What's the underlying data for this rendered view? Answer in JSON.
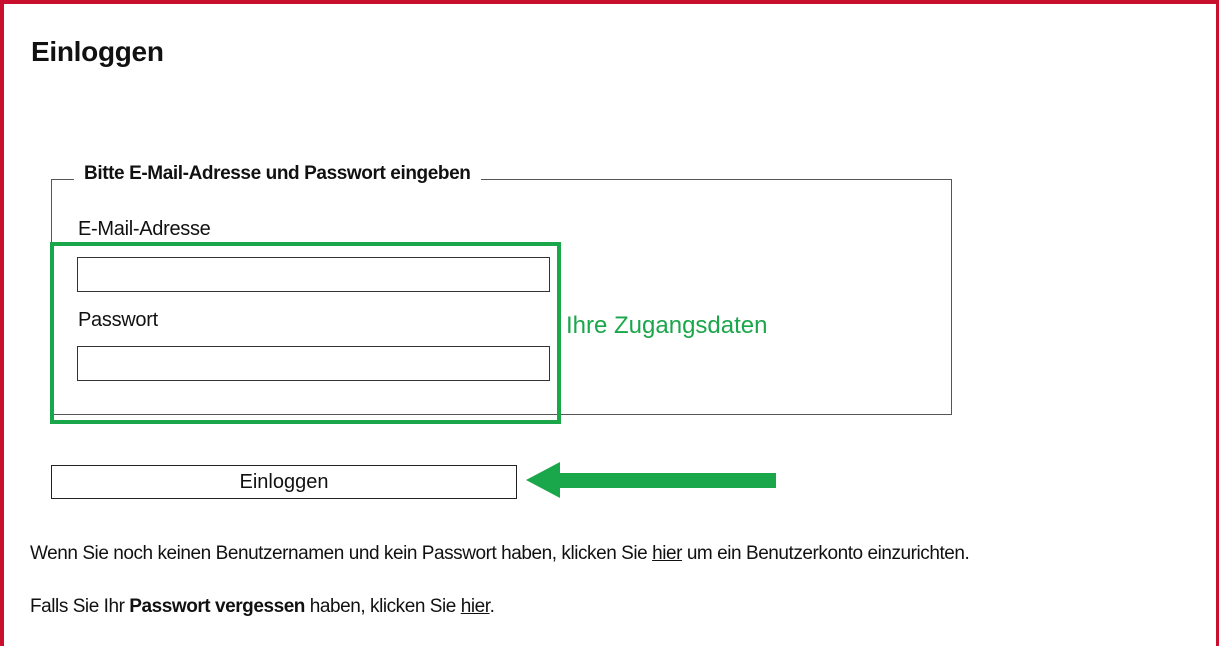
{
  "page": {
    "title": "Einloggen"
  },
  "form": {
    "legend": "Bitte E-Mail-Adresse und Passwort eingeben",
    "email_label": "E-Mail-Adresse",
    "email_value": "",
    "password_label": "Passwort",
    "password_value": "",
    "submit_label": "Einloggen"
  },
  "annotations": {
    "credentials_label": "Ihre Zugangsdaten",
    "highlight_color": "#1aa64a",
    "arrow_color": "#1aa64a",
    "arrow_icon": "arrow-left-icon"
  },
  "info": {
    "register_prefix": "Wenn Sie noch keinen Benutzernamen und kein Passwort haben, klicken Sie ",
    "register_link": "hier",
    "register_suffix": " um ein Benutzerkonto einzurichten.",
    "forgot_prefix": "Falls Sie Ihr ",
    "forgot_bold": "Passwort vergessen",
    "forgot_middle": " haben, klicken Sie ",
    "forgot_link": "hier",
    "forgot_suffix": "."
  },
  "colors": {
    "frame_border": "#c8102e"
  }
}
